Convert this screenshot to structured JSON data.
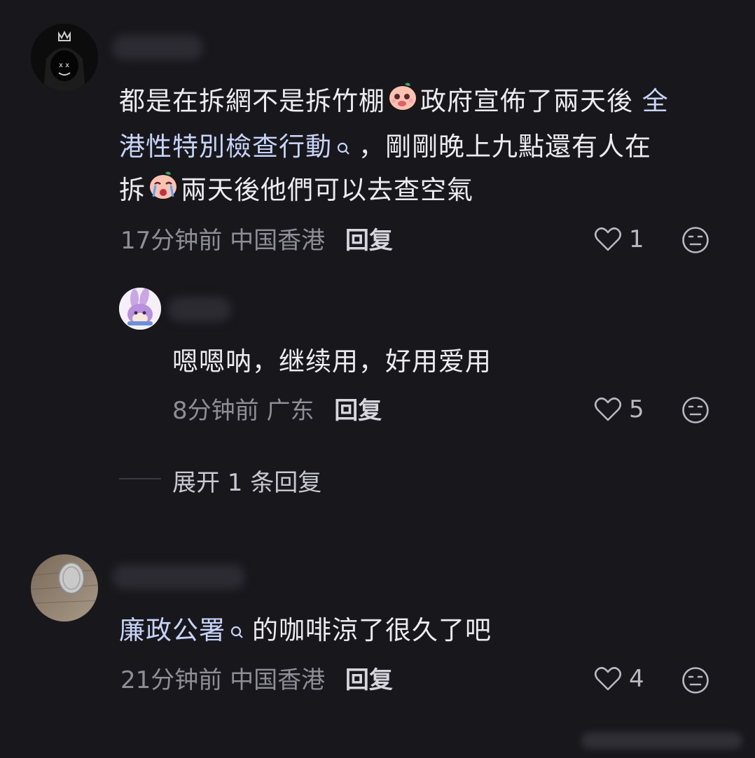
{
  "comments": [
    {
      "text_line1_a": "都是在拆網不是拆竹棚",
      "text_line1_b": "政府宣佈了兩天後",
      "link1_part1": "全",
      "link1_part2": "港性特別檢查行動",
      "text_line2_rest": "，剛剛晚上九點還有人在",
      "text_line3_a": "拆",
      "text_line3_b": "兩天後他們可以去查空氣",
      "time": "17分钟前",
      "location": "中国香港",
      "reply_label": "回复",
      "likes": "1"
    },
    {
      "text": "嗯嗯呐，继续用，好用爱用",
      "time": "8分钟前",
      "location": "广东",
      "reply_label": "回复",
      "likes": "5"
    },
    {
      "link_text": "廉政公署",
      "text_rest": "的咖啡涼了很久了吧",
      "time": "21分钟前",
      "location": "中国香港",
      "reply_label": "回复",
      "likes": "4"
    }
  ],
  "expand_replies": "展开 1 条回复",
  "icons": {
    "heart": "heart-outline-icon",
    "reaction": "neutral-face-icon",
    "search": "search-icon"
  },
  "colors": {
    "background": "#17171c",
    "link": "#c7d3f7",
    "meta": "#8e8e96"
  }
}
